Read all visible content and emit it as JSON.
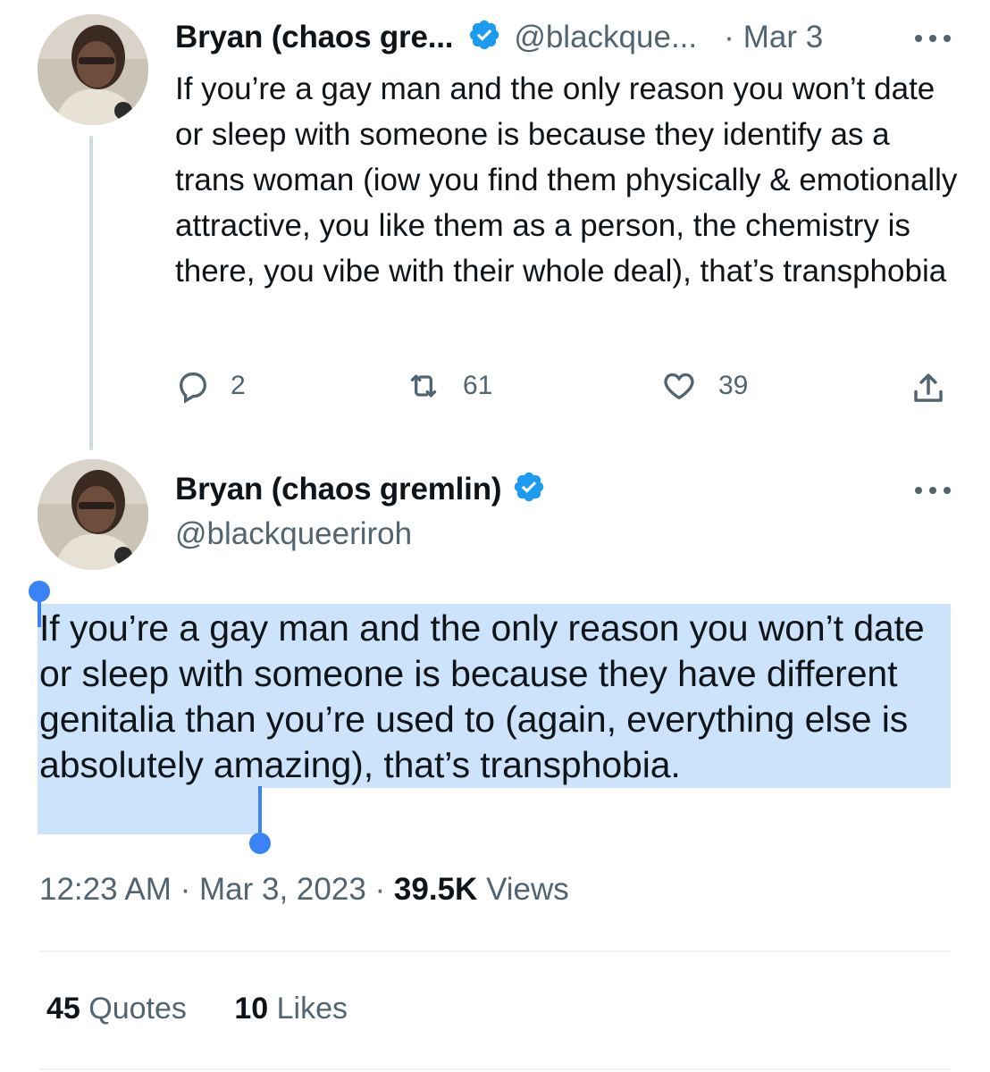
{
  "tweet1": {
    "author_name": "Bryan (chaos gre...",
    "handle": "@blackque...",
    "separator": "·",
    "date": "Mar 3",
    "text": "If you’re a gay man and the only reason you won’t date or sleep with someone is because they identify as a trans woman (iow you find them physically & emotionally attractive, you like them as a person, the chemistry is there, you vibe with their whole deal), that’s transphobia",
    "replies": "2",
    "retweets": "61",
    "likes": "39"
  },
  "tweet2": {
    "author_name": "Bryan (chaos gremlin)",
    "handle": "@blackqueeriroh",
    "text": "If you’re a gay man and the only reason you won’t date or sleep with someone is because they have different genitalia than you’re used to (again, everything else is absolutely amazing), that’s transphobia.",
    "time": "12:23 AM",
    "sep1": "·",
    "full_date": "Mar 3, 2023",
    "sep2": "·",
    "views_count": "39.5K",
    "views_label": "Views",
    "quotes_count": "45",
    "quotes_label": "Quotes",
    "likes_count": "10",
    "likes_label": "Likes"
  },
  "colors": {
    "verified": "#1d9bf0",
    "selection": "#cde3fb",
    "selection_handle": "#3b82f6",
    "secondary_text": "#536471"
  },
  "icons": {
    "reply": "reply-icon",
    "retweet": "retweet-icon",
    "like": "heart-icon",
    "share": "share-icon",
    "more": "more-icon",
    "verified": "verified-badge-icon"
  }
}
